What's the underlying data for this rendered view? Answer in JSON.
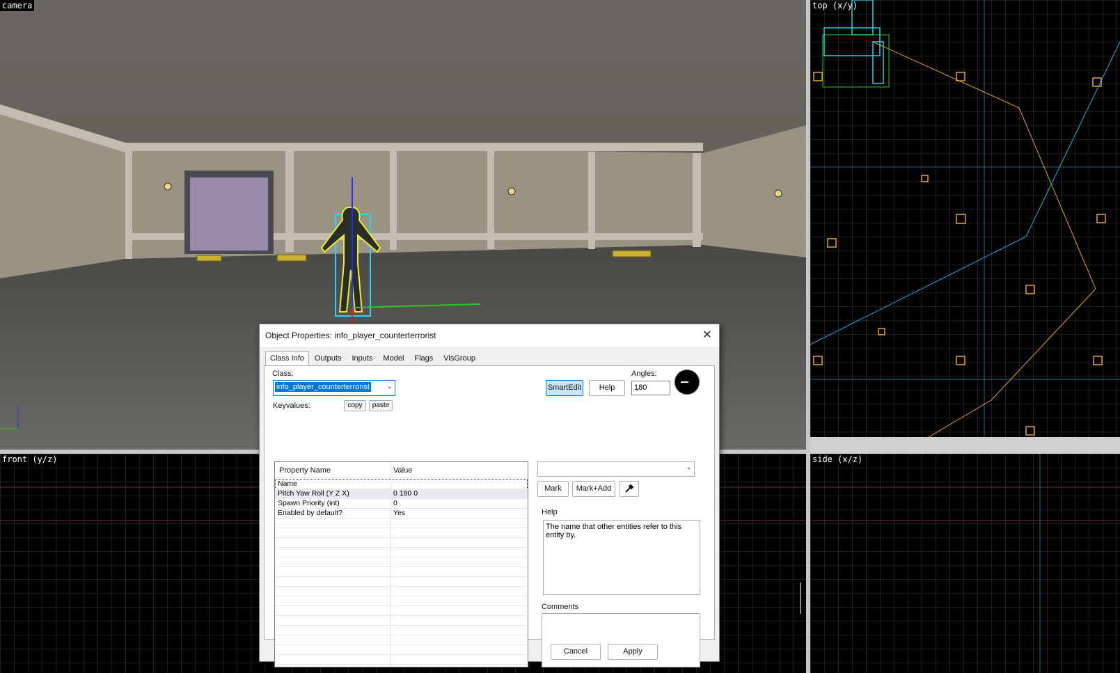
{
  "viewports": {
    "camera": {
      "label": "camera"
    },
    "top": {
      "label": "top (x/y)"
    },
    "front": {
      "label": "front (y/z)"
    },
    "side": {
      "label": "side (x/z)"
    }
  },
  "dialog": {
    "title": "Object Properties: info_player_counterterrorist",
    "close": "✕",
    "tabs": [
      "Class Info",
      "Outputs",
      "Inputs",
      "Model",
      "Flags",
      "VisGroup"
    ],
    "class_label": "Class:",
    "class_value": "info_player_counterterrorist",
    "keyvalues_label": "Keyvalues:",
    "copy": "copy",
    "paste": "paste",
    "smartedit": "SmartEdit",
    "help_btn": "Help",
    "angles_label": "Angles:",
    "angles_value": "180",
    "table": {
      "headers": [
        "Property Name",
        "Value"
      ],
      "rows": [
        {
          "name": "Name",
          "value": ""
        },
        {
          "name": "Pitch Yaw Roll (Y Z X)",
          "value": "0 180 0"
        },
        {
          "name": "Spawn Priority (int)",
          "value": "0"
        },
        {
          "name": "Enabled by default?",
          "value": "Yes"
        }
      ]
    },
    "mark": "Mark",
    "mark_add": "Mark+Add",
    "help_label": "Help",
    "help_text": "The name that other entities refer to this entity by.",
    "comments_label": "Comments",
    "cancel": "Cancel",
    "apply": "Apply"
  },
  "colors": {
    "selection": "#0078d7",
    "grid": "#3a3a3a",
    "entity": "#e7a23a",
    "brush": "#1fd6e0"
  }
}
